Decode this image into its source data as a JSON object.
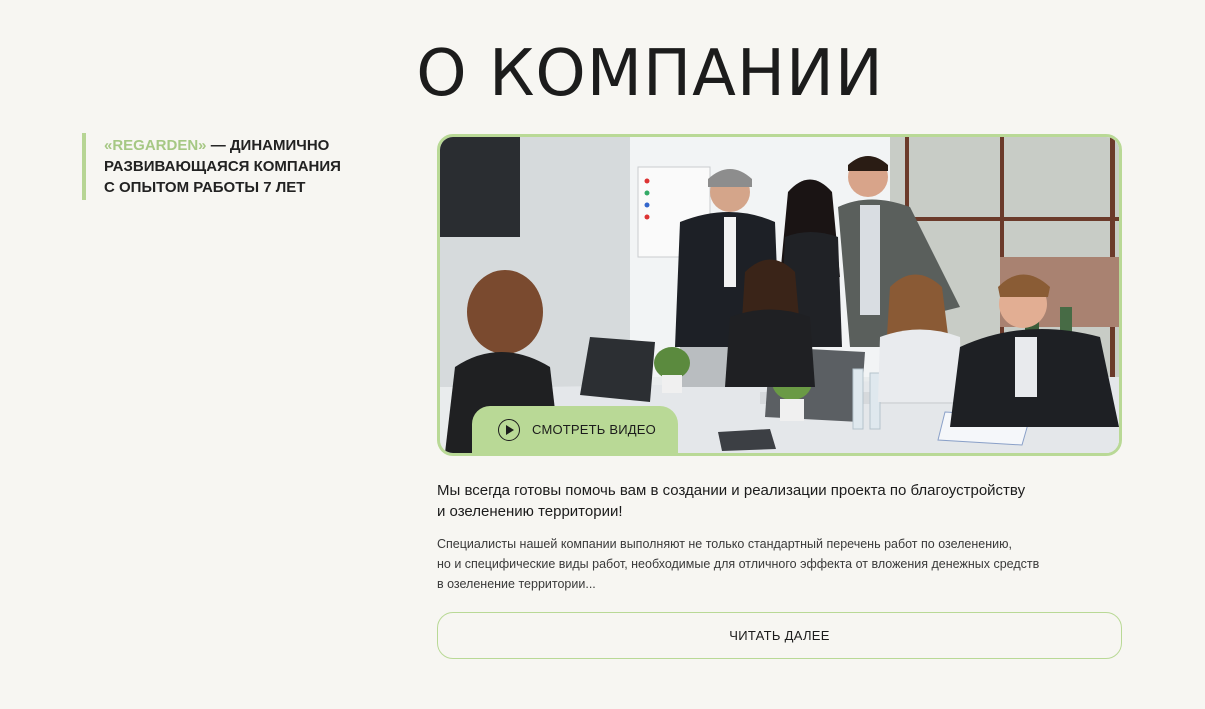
{
  "section": {
    "title": "О КОМПАНИИ"
  },
  "tagline": {
    "brand": "«REGARDEN»",
    "text_line1": " — ДИНАМИЧНО",
    "text_line2": "РАЗВИВАЮЩАЯСЯ КОМПАНИЯ",
    "text_line3": "С ОПЫТОМ РАБОТЫ 7 ЛЕТ"
  },
  "video": {
    "button_label": "СМОТРЕТЬ ВИДЕО",
    "icon": "play-icon"
  },
  "content": {
    "lead_line1": "Мы всегда готовы помочь вам в создании и реализации проекта по благоустройству",
    "lead_line2": "и озеленению территории!",
    "desc_line1": "Специалисты нашей компании выполняют не только стандартный перечень работ по озеленению,",
    "desc_line2": "но и специфические виды работ, необходимые для отличного эффекта от вложения денежных средств",
    "desc_line3": "в озеленение территории..."
  },
  "actions": {
    "read_more_label": "ЧИТАТЬ ДАЛЕЕ"
  },
  "colors": {
    "background": "#f7f6f2",
    "accent": "#b9d996",
    "brand_text": "#a6c884",
    "text": "#1c1c1c"
  }
}
